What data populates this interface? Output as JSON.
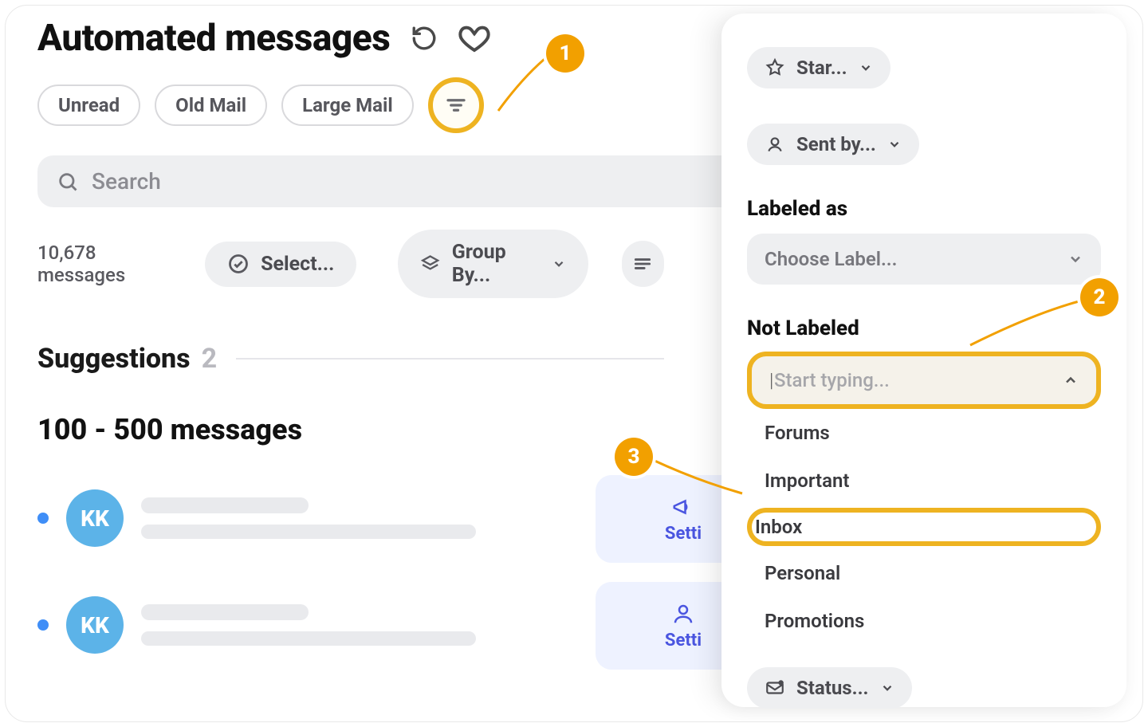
{
  "header": {
    "title": "Automated messages"
  },
  "chips": {
    "unread": "Unread",
    "old_mail": "Old Mail",
    "large_mail": "Large Mail"
  },
  "search": {
    "placeholder": "Search"
  },
  "toolbar": {
    "message_count": "10,678 messages",
    "select_label": "Select...",
    "group_by_label": "Group By..."
  },
  "suggestions": {
    "title": "Suggestions",
    "count": "2"
  },
  "bucket": {
    "title": "100 - 500 messages"
  },
  "messages": [
    {
      "avatar": "KK",
      "action_label": "Setti"
    },
    {
      "avatar": "KK",
      "action_label": "Setti"
    }
  ],
  "popup": {
    "star_label": "Star...",
    "sent_by_label": "Sent by...",
    "labeled_as_title": "Labeled as",
    "choose_label_placeholder": "Choose Label...",
    "not_labeled_title": "Not Labeled",
    "typing_placeholder": "Start typing...",
    "options": {
      "forums": "Forums",
      "important": "Important",
      "inbox": "Inbox",
      "personal": "Personal",
      "promotions": "Promotions"
    },
    "status_label": "Status..."
  },
  "callouts": {
    "c1": "1",
    "c2": "2",
    "c3": "3"
  }
}
